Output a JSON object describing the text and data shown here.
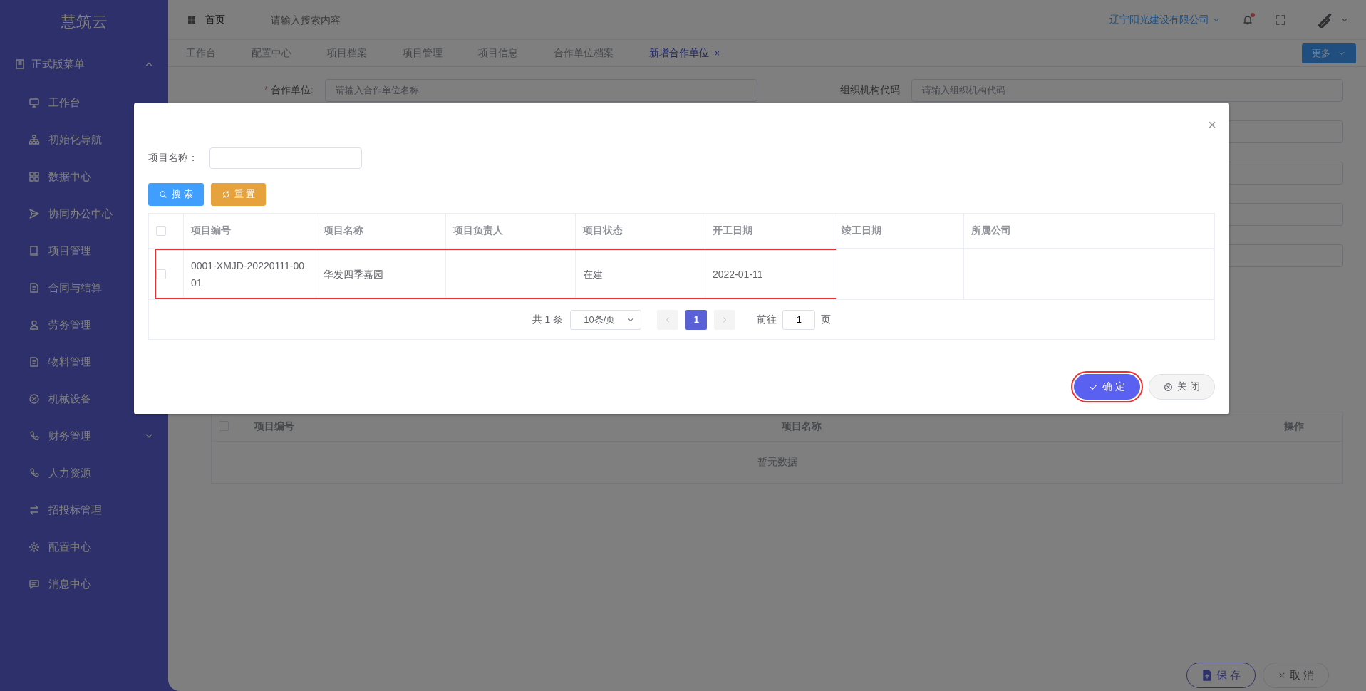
{
  "sidebar": {
    "logo": "慧筑云",
    "section": {
      "label": "正式版菜单",
      "expanded": true
    },
    "items": [
      {
        "label": "工作台"
      },
      {
        "label": "初始化导航"
      },
      {
        "label": "数据中心"
      },
      {
        "label": "协同办公中心"
      },
      {
        "label": "项目管理"
      },
      {
        "label": "合同与结算"
      },
      {
        "label": "劳务管理"
      },
      {
        "label": "物料管理"
      },
      {
        "label": "机械设备"
      },
      {
        "label": "财务管理",
        "expandable": true
      },
      {
        "label": "人力资源",
        "expandable": false
      },
      {
        "label": "招投标管理",
        "expandable": false
      },
      {
        "label": "配置中心",
        "expandable": false
      },
      {
        "label": "消息中心",
        "expandable": false
      }
    ]
  },
  "header": {
    "home": "首页",
    "search_placeholder": "请输入搜索内容",
    "company": "辽宁阳光建设有限公司",
    "has_unread": true
  },
  "tabs": [
    {
      "label": "工作台",
      "selected": false
    },
    {
      "label": "配置中心",
      "selected": false
    },
    {
      "label": "项目档案",
      "selected": false
    },
    {
      "label": "项目管理",
      "selected": false
    },
    {
      "label": "项目信息",
      "selected": false
    },
    {
      "label": "合作单位档案",
      "selected": false
    },
    {
      "label": "新增合作单位",
      "selected": true,
      "close": "×"
    }
  ],
  "more_button": "更多",
  "form": {
    "fields": [
      {
        "kind": "text",
        "label": "合作单位:",
        "required_mark": "*",
        "placeholder": "请输入合作单位名称"
      },
      {
        "kind": "text",
        "label": "组织机构代码",
        "placeholder": "请输入组织机构代码"
      },
      {
        "kind": "blank"
      },
      {
        "kind": "blank"
      },
      {
        "kind": "blank"
      },
      {
        "kind": "blank"
      }
    ]
  },
  "table": {
    "all_checked": false,
    "columns": [
      "项目编号",
      "项目名称",
      "操作"
    ],
    "empty_text": "暂无数据"
  },
  "actions": [
    {
      "label": "保 存",
      "kind": "save"
    },
    {
      "label": "取 消",
      "kind": "cancel"
    }
  ],
  "dialog": {
    "close": "×",
    "search_label": "项目名称：",
    "buttons": [
      {
        "label": "搜 索",
        "kind": "search"
      },
      {
        "label": "重 置",
        "kind": "reset"
      }
    ],
    "table": {
      "all_checked": false,
      "columns": [
        "项目编号",
        "项目名称",
        "项目负责人",
        "项目状态",
        "开工日期",
        "竣工日期",
        "所属公司"
      ],
      "rows": [
        {
          "checked": false,
          "highlighted": true,
          "cells": [
            "0001-XMJD-20220111-0001",
            "华发四季嘉园",
            null,
            "在建",
            "2022-01-11",
            null,
            null
          ]
        }
      ]
    },
    "pagination": {
      "total": "共 1 条",
      "page_size": "10条/页",
      "pages": [
        {
          "label": "1",
          "selected": true
        }
      ],
      "goto_label": "前往",
      "goto_value": "1",
      "goto_suffix": "页"
    },
    "footer_buttons": [
      {
        "label": "确 定",
        "kind": "confirm",
        "highlighted": true
      },
      {
        "label": "关 闭",
        "kind": "close",
        "highlighted": false
      }
    ]
  }
}
